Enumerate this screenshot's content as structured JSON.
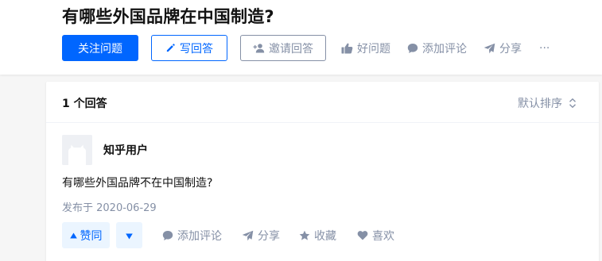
{
  "question": {
    "title": "有哪些外国品牌在中国制造?",
    "follow_label": "关注问题",
    "write_label": "写回答",
    "invite_label": "邀请回答",
    "good_question_label": "好问题",
    "add_comment_label": "添加评论",
    "share_label": "分享",
    "more_label": "···"
  },
  "answers": {
    "count_label": "1 个回答",
    "sort_label": "默认排序",
    "item": {
      "author": "知乎用户",
      "content": "有哪些外国品牌不在中国制造?",
      "published": "发布于 2020-06-29",
      "upvote_label": "赞同",
      "comment_label": "添加评论",
      "share_label": "分享",
      "collect_label": "收藏",
      "like_label": "喜欢"
    }
  },
  "colors": {
    "brand": "#0066ff",
    "muted": "#8590a6",
    "vote_bg": "#ebf5ff",
    "page_bg": "#f6f6f6"
  },
  "icons": [
    "pencil-icon",
    "add-person-icon",
    "thumbs-up-icon",
    "comment-icon",
    "paper-plane-icon",
    "sort-arrows-icon",
    "triangle-up-icon",
    "triangle-down-icon",
    "star-icon",
    "heart-icon",
    "default-avatar-icon"
  ]
}
